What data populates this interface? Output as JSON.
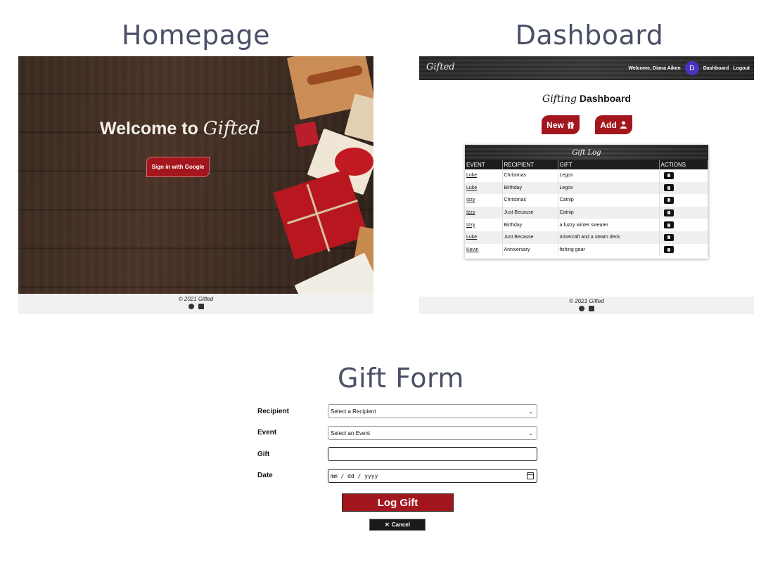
{
  "sections": {
    "homepage_title": "Homepage",
    "dashboard_title": "Dashboard",
    "form_title": "Gift Form"
  },
  "homepage": {
    "welcome_prefix": "Welcome to",
    "welcome_brand": "Gifted",
    "signin_label": "Sign in with Google",
    "footer_copy": "© 2021 Gifted"
  },
  "dashboard": {
    "brand": "Gifted",
    "welcome_user": "Welcome, Diana Aiken",
    "avatar_letter": "D",
    "nav_dashboard": "Dashboard",
    "nav_logout": "Logout",
    "heading_script": "Gifting",
    "heading_bold": "Dashboard",
    "new_button": "New",
    "add_button": "Add",
    "log_title": "Gift Log",
    "columns": [
      "EVENT",
      "RECIPIENT",
      "GIFT",
      "ACTIONS"
    ],
    "rows": [
      {
        "event": "Luke",
        "recipient": "Christmas",
        "gift": "Legos"
      },
      {
        "event": "Luke",
        "recipient": "Birthday",
        "gift": "Legos"
      },
      {
        "event": "Izzy",
        "recipient": "Christmas",
        "gift": "Catnip"
      },
      {
        "event": "Izzy",
        "recipient": "Just Because",
        "gift": "Catnip"
      },
      {
        "event": "Izzy",
        "recipient": "Birthday",
        "gift": "a fuzzy winter sweater"
      },
      {
        "event": "Luke",
        "recipient": "Just Because",
        "gift": "minecraft and a steam deck"
      },
      {
        "event": "Kevin",
        "recipient": "Anniversary",
        "gift": "fishing gear"
      }
    ],
    "footer_copy": "© 2021 Gifted"
  },
  "form": {
    "recipient_label": "Recipient",
    "recipient_value": "Select a Recipient",
    "event_label": "Event",
    "event_value": "Select an Event",
    "gift_label": "Gift",
    "gift_value": "",
    "date_label": "Date",
    "date_placeholder": "mm / dd / yyyy",
    "submit_label": "Log Gift",
    "cancel_label": "Cancel"
  },
  "colors": {
    "accent_red": "#a3161d",
    "title_slate": "#4a5066",
    "avatar_purple": "#4a33c2"
  },
  "icons": [
    "gift-icon",
    "user-icon",
    "trash-icon",
    "github-icon",
    "linkedin-icon",
    "close-icon",
    "calendar-icon",
    "chevron-down-icon"
  ]
}
